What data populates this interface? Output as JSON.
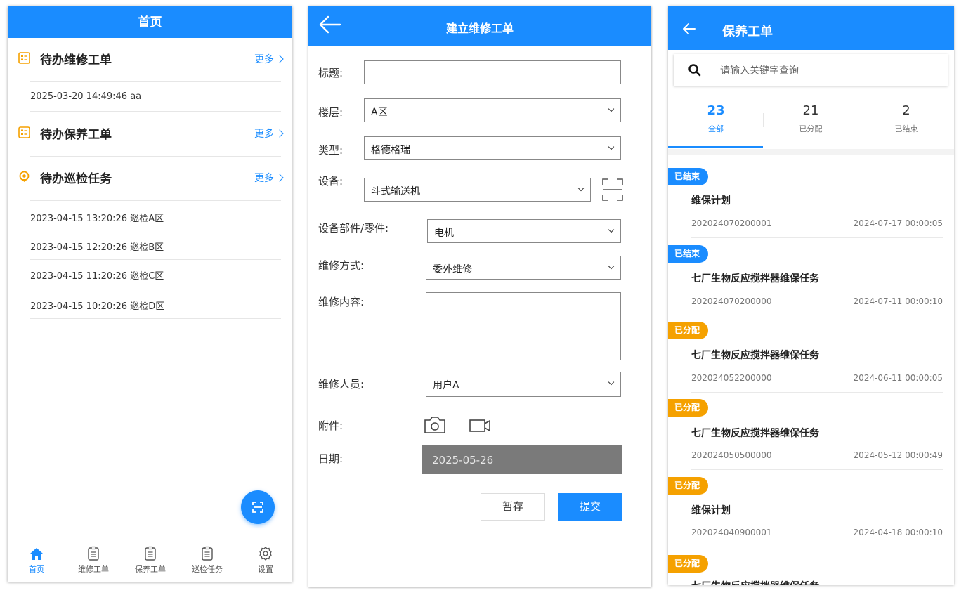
{
  "home": {
    "title": "首页",
    "sections": [
      {
        "title": "待办维修工单",
        "more": "更多"
      },
      {
        "title": "待办保养工单",
        "more": "更多"
      },
      {
        "title": "待办巡检任务",
        "more": "更多"
      }
    ],
    "repair_items": [
      "2025-03-20 14:49:46 aa"
    ],
    "patrol_items": [
      "2023-04-15 13:20:26 巡检A区",
      "2023-04-15 12:20:26 巡检B区",
      "2023-04-15 11:20:26 巡检C区",
      "2023-04-15 10:20:26 巡检D区"
    ],
    "tabbar": [
      {
        "label": "首页",
        "icon": "home-icon"
      },
      {
        "label": "维修工单",
        "icon": "clipboard-icon"
      },
      {
        "label": "保养工单",
        "icon": "clipboard-icon"
      },
      {
        "label": "巡检任务",
        "icon": "clipboard-icon"
      },
      {
        "label": "设置",
        "icon": "gear-icon"
      }
    ],
    "accent": "#1a8cff",
    "section_icon_color": "#f5a100"
  },
  "repair_form": {
    "title": "建立维修工单",
    "labels": {
      "title": "标题:",
      "floor": "楼层:",
      "type": "类型:",
      "device": "设备:",
      "part": "设备部件/零件:",
      "method": "维修方式:",
      "content": "维修内容:",
      "staff": "维修人员:",
      "attachment": "附件:",
      "date": "日期:"
    },
    "values": {
      "title": "",
      "floor": "A区",
      "type": "格德格瑞",
      "device": "斗式输送机",
      "part": "电机",
      "method": "委外维修",
      "content": "",
      "staff": "用户A",
      "date": "2025-05-26"
    },
    "buttons": {
      "save": "暂存",
      "submit": "提交"
    }
  },
  "maintenance": {
    "title": "保养工单",
    "search_placeholder": "请输入关键字查询",
    "stats": [
      {
        "count": "23",
        "label": "全部"
      },
      {
        "count": "21",
        "label": "已分配"
      },
      {
        "count": "2",
        "label": "已结束"
      }
    ],
    "orders": [
      {
        "status": "已结束",
        "status_color": "#1a8cff",
        "name": "维保计划",
        "code": "202024070200001",
        "time": "2024-07-17 00:00:05"
      },
      {
        "status": "已结束",
        "status_color": "#1a8cff",
        "name": "七厂生物反应搅拌器维保任务",
        "code": "202024070200000",
        "time": "2024-07-11 00:00:10"
      },
      {
        "status": "已分配",
        "status_color": "#f5a100",
        "name": "七厂生物反应搅拌器维保任务",
        "code": "202024052200000",
        "time": "2024-06-11 00:00:05"
      },
      {
        "status": "已分配",
        "status_color": "#f5a100",
        "name": "七厂生物反应搅拌器维保任务",
        "code": "202024050500000",
        "time": "2024-05-12 00:00:49"
      },
      {
        "status": "已分配",
        "status_color": "#f5a100",
        "name": "维保计划",
        "code": "202024040900001",
        "time": "2024-04-18 00:00:10"
      },
      {
        "status": "已分配",
        "status_color": "#f5a100",
        "name": "七厂生物反应搅拌器维保任务",
        "code": "",
        "time": ""
      }
    ]
  }
}
